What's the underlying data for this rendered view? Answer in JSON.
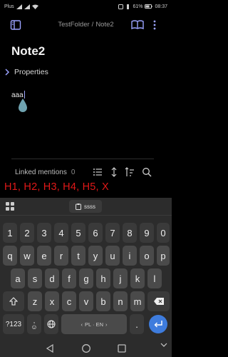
{
  "status": {
    "carrier": "Plus",
    "battery": "61%",
    "time": "08:37"
  },
  "header": {
    "folder": "TestFolder",
    "separator": "/",
    "note": "Note2"
  },
  "note": {
    "title": "Note2",
    "properties_label": "Properties",
    "body_text": "aaa"
  },
  "linked_mentions": {
    "label": "Linked mentions",
    "count": "0"
  },
  "overlay": {
    "text": "H1, H2, H3, H4, H5, X"
  },
  "keyboard": {
    "clipboard_chip": "ssss",
    "row_numbers": [
      "1",
      "2",
      "3",
      "4",
      "5",
      "6",
      "7",
      "8",
      "9",
      "0"
    ],
    "row_top": [
      "q",
      "w",
      "e",
      "r",
      "t",
      "y",
      "u",
      "i",
      "o",
      "p"
    ],
    "row_middle": [
      "a",
      "s",
      "d",
      "f",
      "g",
      "h",
      "j",
      "k",
      "l"
    ],
    "row_bottom": [
      "z",
      "x",
      "c",
      "v",
      "b",
      "n",
      "m"
    ],
    "symbols_key": "?123",
    "emoji_key": "☺",
    "emoji_key_top": ",",
    "space_label": "PL · EN",
    "period_key": "."
  },
  "colors": {
    "accent": "#3e7cdd",
    "overlay_red": "#e01818",
    "cursor_handle": "#6fa3b0"
  }
}
